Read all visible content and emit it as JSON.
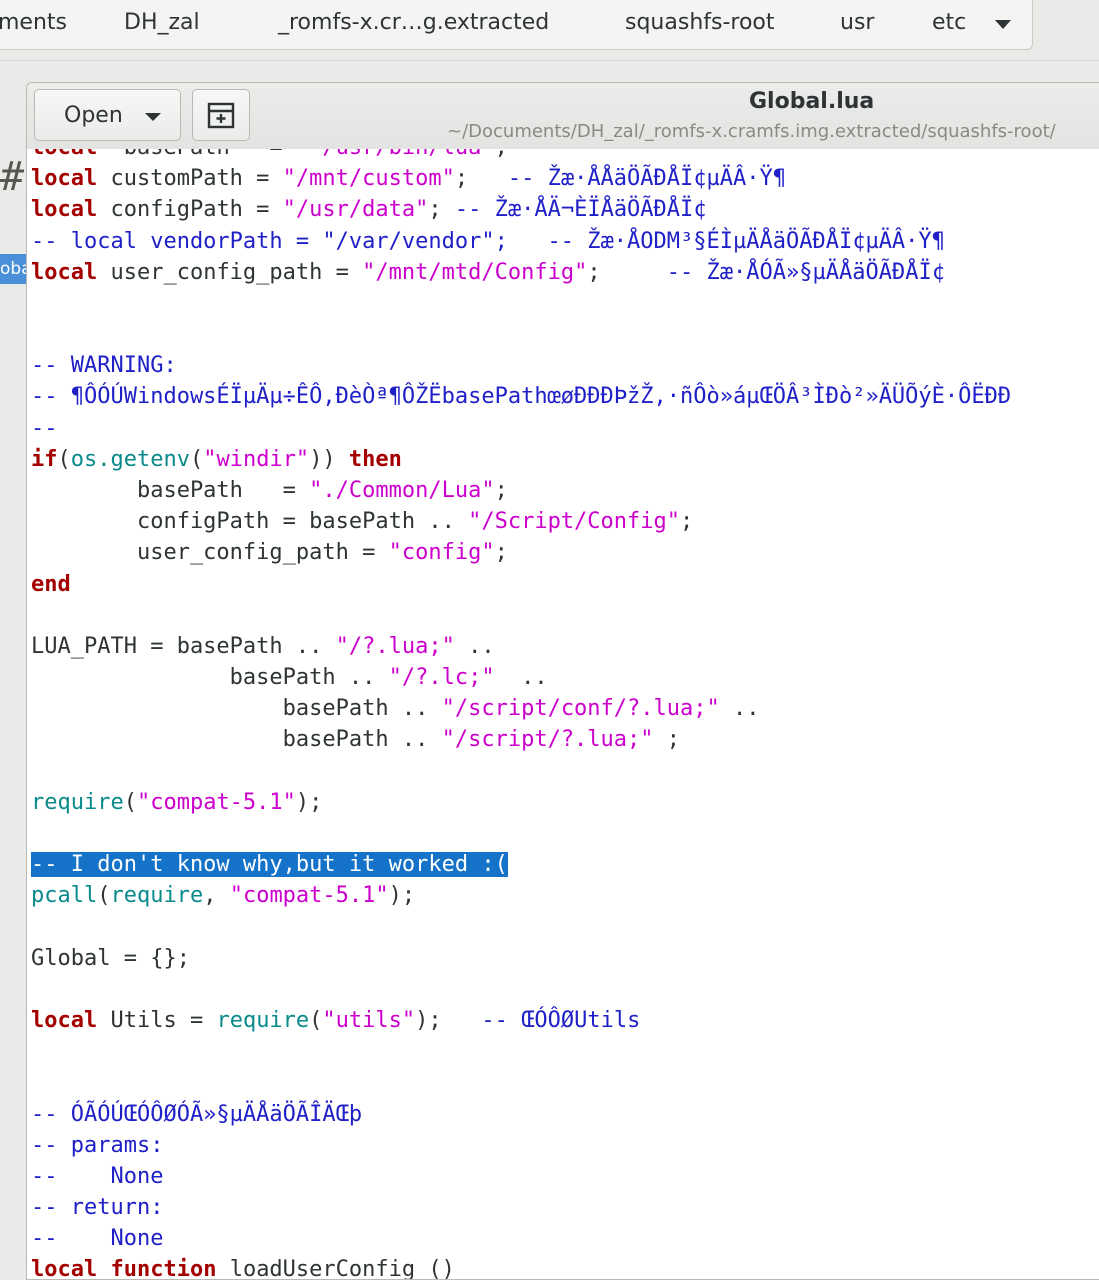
{
  "pathbar": {
    "crumbs": [
      "ments",
      "DH_zal",
      "_romfs-x.cr…g.extracted",
      "squashfs-root",
      "usr",
      "etc"
    ]
  },
  "file_manager": {
    "hash_glyph": "#",
    "selected_item_partial": "oba"
  },
  "editor": {
    "open_label": "Open",
    "title": "Global.lua",
    "subtitle": "~/Documents/DH_zal/_romfs-x.cramfs.img.extracted/squashfs-root/"
  },
  "code_lines": [
    [
      [
        "kw",
        "local"
      ],
      [
        "",
        "  basePath   =  "
      ],
      [
        "str",
        "\"/usr/bin/lua\""
      ],
      [
        "",
        ";"
      ]
    ],
    [
      [
        "kw",
        "local"
      ],
      [
        "",
        " customPath = "
      ],
      [
        "str",
        "\"/mnt/custom\""
      ],
      [
        "",
        ";   "
      ],
      [
        "cm",
        "-- Žæ·ÅÅäÖÃÐÅÏ¢µÄÂ·Ÿ¶"
      ]
    ],
    [
      [
        "kw",
        "local"
      ],
      [
        "",
        " configPath = "
      ],
      [
        "str",
        "\"/usr/data\""
      ],
      [
        "",
        "; "
      ],
      [
        "cm",
        "-- Žæ·ÅÄ¬ÈÏÅäÖÃÐÅÏ¢"
      ]
    ],
    [
      [
        "cm",
        "-- local vendorPath = \"/var/vendor\";   -- Žæ·ÅODM³§ÉÌµÄÅäÖÃÐÅÏ¢µÄÂ·Ÿ¶"
      ]
    ],
    [
      [
        "kw",
        "local"
      ],
      [
        "",
        " user_config_path = "
      ],
      [
        "str",
        "\"/mnt/mtd/Config\""
      ],
      [
        "",
        ";     "
      ],
      [
        "cm",
        "-- Žæ·ÅÓÃ»§µÄÅäÖÃÐÅÏ¢"
      ]
    ],
    [],
    [],
    [
      [
        "cm",
        "-- WARNING:"
      ]
    ],
    [
      [
        "cm",
        "-- ¶ÔÓÚWindowsÉÏµÄµ÷ÊÔ,ÐèÒª¶ÔŽËbasePathœøÐÐÐÞžŽ,·ñÔò»áµŒÖÂ³ÌÐò²»ÄÜÕýÈ·ÔËÐÐ"
      ]
    ],
    [
      [
        "cm",
        "--"
      ]
    ],
    [
      [
        "kw",
        "if"
      ],
      [
        "",
        "("
      ],
      [
        "fn",
        "os.getenv"
      ],
      [
        "",
        "("
      ],
      [
        "str",
        "\"windir\""
      ],
      [
        "",
        "))"
      ],
      [
        "kw",
        " then"
      ]
    ],
    [
      [
        "",
        "        basePath   = "
      ],
      [
        "str",
        "\"./Common/Lua\""
      ],
      [
        "",
        ";"
      ]
    ],
    [
      [
        "",
        "        configPath = basePath .. "
      ],
      [
        "str",
        "\"/Script/Config\""
      ],
      [
        "",
        ";"
      ]
    ],
    [
      [
        "",
        "        user_config_path = "
      ],
      [
        "str",
        "\"config\""
      ],
      [
        "",
        ";"
      ]
    ],
    [
      [
        "kw",
        "end"
      ]
    ],
    [],
    [
      [
        "",
        "LUA_PATH = basePath .. "
      ],
      [
        "str",
        "\"/?.lua;\""
      ],
      [
        "",
        " .."
      ]
    ],
    [
      [
        "",
        "               basePath .. "
      ],
      [
        "str",
        "\"/?.lc;\""
      ],
      [
        "",
        "  .."
      ]
    ],
    [
      [
        "",
        "                   basePath .. "
      ],
      [
        "str",
        "\"/script/conf/?.lua;\""
      ],
      [
        "",
        " .."
      ]
    ],
    [
      [
        "",
        "                   basePath .. "
      ],
      [
        "str",
        "\"/script/?.lua;\""
      ],
      [
        "",
        " ;"
      ]
    ],
    [],
    [
      [
        "fn",
        "require"
      ],
      [
        "",
        "("
      ],
      [
        "str",
        "\"compat-5.1\""
      ],
      [
        "",
        ");"
      ]
    ],
    [],
    [
      [
        "hl",
        "-- I don't know why,but it worked :("
      ]
    ],
    [
      [
        "fn",
        "pcall"
      ],
      [
        "",
        "("
      ],
      [
        "fn",
        "require"
      ],
      [
        "",
        ", "
      ],
      [
        "str",
        "\"compat-5.1\""
      ],
      [
        "",
        ");"
      ]
    ],
    [],
    [
      [
        "",
        "Global = {};"
      ]
    ],
    [],
    [
      [
        "kw",
        "local"
      ],
      [
        "",
        " Utils = "
      ],
      [
        "fn",
        "require"
      ],
      [
        "",
        "("
      ],
      [
        "str",
        "\"utils\""
      ],
      [
        "",
        ");   "
      ],
      [
        "cm",
        "-- ŒÓÔØUtils"
      ]
    ],
    [],
    [],
    [
      [
        "cm",
        "-- ÓÃÓÚŒÓÔØÓÃ»§µÄÅäÖÃÎÄŒþ"
      ]
    ],
    [
      [
        "cm",
        "-- params:"
      ]
    ],
    [
      [
        "cm",
        "--    None"
      ]
    ],
    [
      [
        "cm",
        "-- return:"
      ]
    ],
    [
      [
        "cm",
        "--    None"
      ]
    ],
    [
      [
        "kw",
        "local"
      ],
      [
        "",
        " "
      ],
      [
        "kw",
        "function"
      ],
      [
        "",
        " loadUserConfig ()"
      ]
    ]
  ]
}
